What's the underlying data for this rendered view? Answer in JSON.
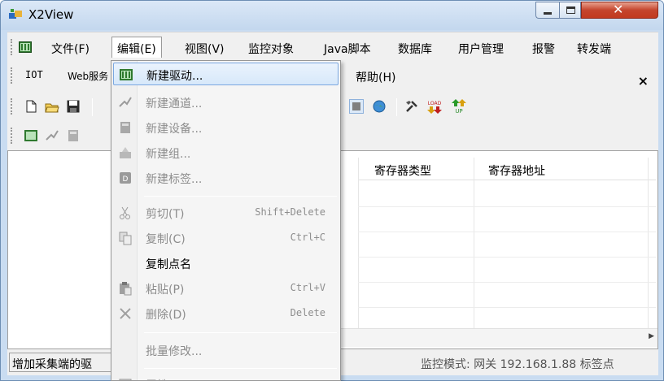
{
  "window": {
    "title": "X2View"
  },
  "menubar": {
    "items": [
      "文件(F)",
      "编辑(E)",
      "视图(V)",
      "监控对象",
      "Java脚本",
      "数据库",
      "用户管理",
      "报警",
      "转发端"
    ],
    "active": "编辑(E)"
  },
  "menubar2": {
    "items": [
      "IOT",
      "Web服务"
    ],
    "help": "帮助(H)",
    "close": "×"
  },
  "toolbar": {
    "icons": [
      "new-icon",
      "open-icon",
      "save-icon",
      "stop-icon",
      "globe-icon",
      "tools-icon",
      "load-icon",
      "up-icon"
    ],
    "load_label": "LOAD",
    "up_label": "UP"
  },
  "grid": {
    "columns": [
      "寄存器类型",
      "寄存器地址"
    ]
  },
  "statusbar": {
    "left": "增加采集端的驱",
    "right_mode": "监控模式: 网关",
    "right_ip": "192.168.1.88",
    "right_tail": "标签点"
  },
  "edit_menu": {
    "items": [
      {
        "label": "新建驱动...",
        "state": "highlight",
        "icon": "driver-icon"
      },
      {
        "label": "新建通道...",
        "state": "disabled",
        "icon": "channel-icon"
      },
      {
        "label": "新建设备...",
        "state": "disabled",
        "icon": "device-icon"
      },
      {
        "label": "新建组...",
        "state": "disabled",
        "icon": "group-icon"
      },
      {
        "label": "新建标签...",
        "state": "disabled",
        "icon": "tag-icon"
      },
      {
        "label": "剪切(T)",
        "shortcut": "Shift+Delete",
        "state": "disabled",
        "icon": "cut-icon"
      },
      {
        "label": "复制(C)",
        "shortcut": "Ctrl+C",
        "state": "disabled",
        "icon": "copy-icon"
      },
      {
        "label": "复制点名",
        "state": "enabled",
        "icon": ""
      },
      {
        "label": "粘贴(P)",
        "shortcut": "Ctrl+V",
        "state": "disabled",
        "icon": "paste-icon"
      },
      {
        "label": "删除(D)",
        "shortcut": "Delete",
        "state": "disabled",
        "icon": "delete-icon"
      },
      {
        "label": "批量修改...",
        "state": "disabled",
        "icon": ""
      },
      {
        "label": "属性",
        "state": "disabled",
        "icon": "properties-icon"
      }
    ]
  },
  "colors": {
    "highlight_border": "#7aa7e0",
    "disabled_text": "#8d8d8d",
    "close_button": "#c4452d"
  }
}
